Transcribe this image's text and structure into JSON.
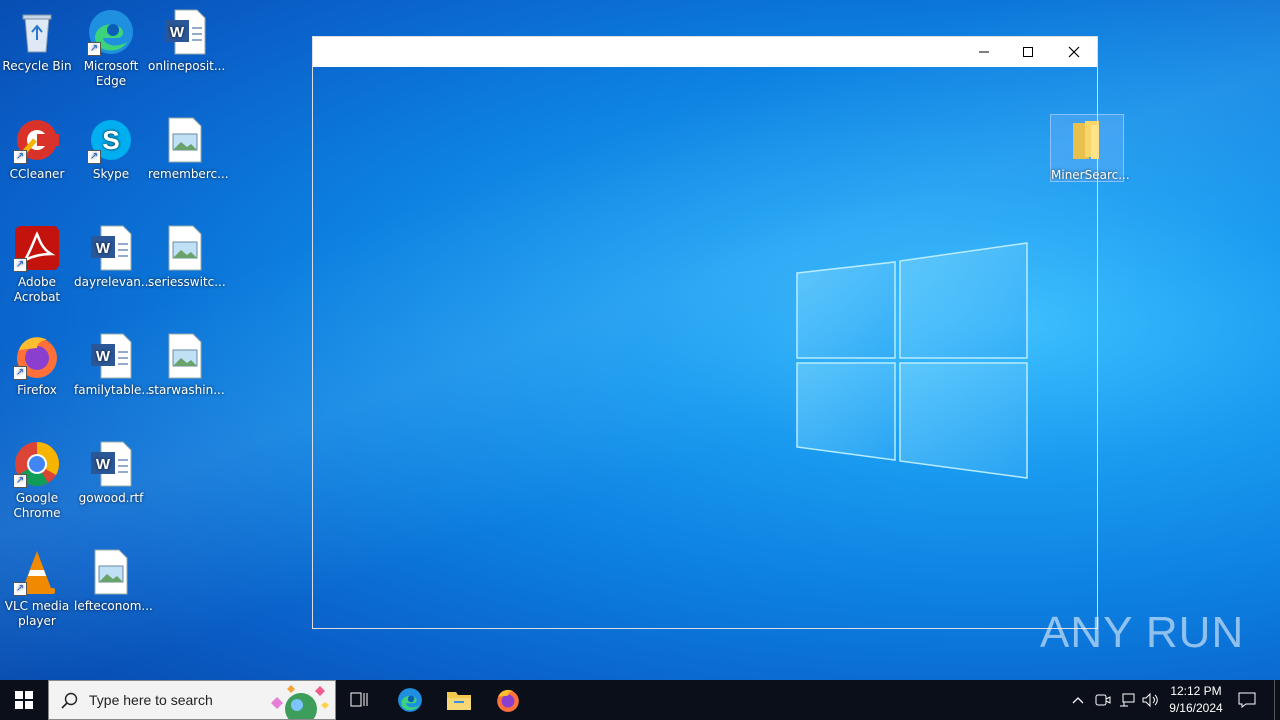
{
  "desktop": {
    "icons": [
      {
        "label": "Recycle Bin"
      },
      {
        "label": "Microsoft Edge"
      },
      {
        "label": "onlineposit..."
      },
      {
        "label": "CCleaner"
      },
      {
        "label": "Skype"
      },
      {
        "label": "rememberc..."
      },
      {
        "label": "Adobe Acrobat"
      },
      {
        "label": "dayrelevan..."
      },
      {
        "label": "seriesswitc..."
      },
      {
        "label": "Firefox"
      },
      {
        "label": "familytable..."
      },
      {
        "label": "starwashin..."
      },
      {
        "label": "Google Chrome"
      },
      {
        "label": "gowood.rtf"
      },
      {
        "label": "VLC media player"
      },
      {
        "label": "lefteconom..."
      },
      {
        "label": "MinerSearc..."
      }
    ]
  },
  "window": {
    "minimize_icon": "minimize-icon",
    "maximize_icon": "maximize-icon",
    "close_icon": "close-icon"
  },
  "taskbar": {
    "search_placeholder": "Type here to search",
    "time": "12:12 PM",
    "date": "9/16/2024"
  },
  "watermark": "ANY RUN",
  "colors": {
    "taskbar_bg": "#0b0f19",
    "desktop_accent": "#1a9bf0"
  }
}
